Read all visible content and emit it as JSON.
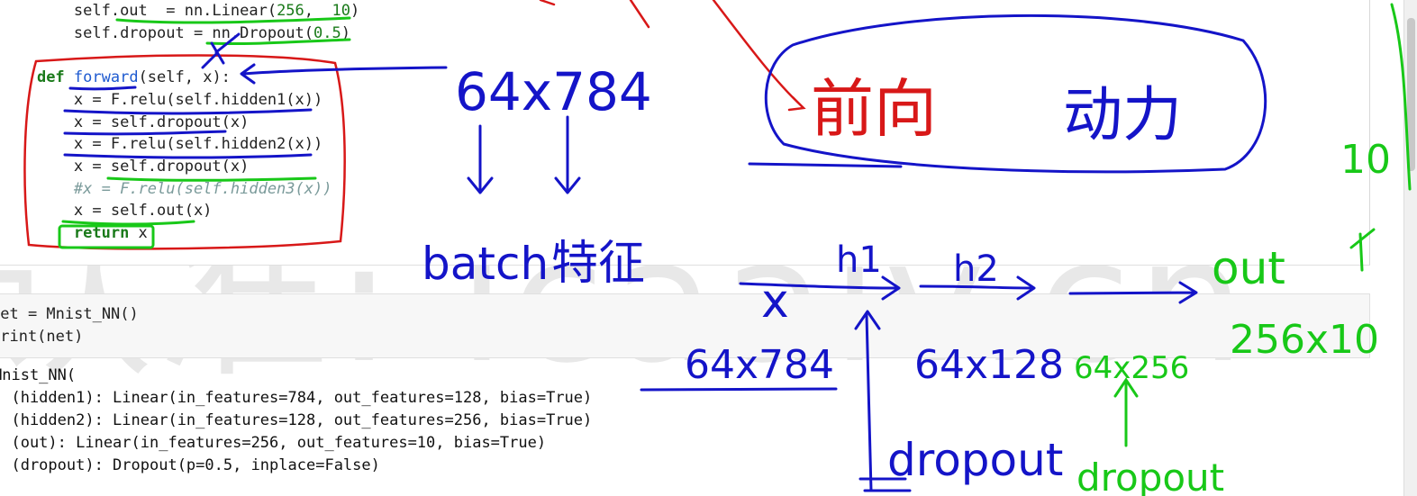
{
  "code_cell": {
    "lines": [
      {
        "indent": "    ",
        "parts": [
          {
            "t": "self.out  = nn.Linear(",
            "c": ""
          },
          {
            "t": "256",
            "c": "num"
          },
          {
            "t": ",  ",
            "c": ""
          },
          {
            "t": "10",
            "c": "num"
          },
          {
            "t": ")",
            "c": ""
          }
        ]
      },
      {
        "indent": "    ",
        "parts": [
          {
            "t": "self.dropout = nn.Dropout(",
            "c": ""
          },
          {
            "t": "0.5",
            "c": "num"
          },
          {
            "t": ")",
            "c": ""
          }
        ]
      },
      {
        "indent": "",
        "parts": [
          {
            "t": "",
            "c": ""
          }
        ]
      },
      {
        "indent": "",
        "parts": [
          {
            "t": "def ",
            "c": "kw"
          },
          {
            "t": "forward",
            "c": "fn"
          },
          {
            "t": "(self, x):",
            "c": ""
          }
        ]
      },
      {
        "indent": "    ",
        "parts": [
          {
            "t": "x = F.relu(self.hidden1(x))",
            "c": ""
          }
        ]
      },
      {
        "indent": "    ",
        "parts": [
          {
            "t": "x = self.dropout(x)",
            "c": ""
          }
        ]
      },
      {
        "indent": "    ",
        "parts": [
          {
            "t": "x = F.relu(self.hidden2(x))",
            "c": ""
          }
        ]
      },
      {
        "indent": "    ",
        "parts": [
          {
            "t": "x = self.dropout(x)",
            "c": ""
          }
        ]
      },
      {
        "indent": "    ",
        "parts": [
          {
            "t": "#x = F.relu(self.hidden3(x))",
            "c": "cm"
          }
        ]
      },
      {
        "indent": "    ",
        "parts": [
          {
            "t": "x = self.out(x)",
            "c": ""
          }
        ]
      },
      {
        "indent": "    ",
        "parts": [
          {
            "t": "return",
            "c": "kw"
          },
          {
            "t": " x",
            "c": ""
          }
        ]
      }
    ]
  },
  "net_cell": {
    "lines": [
      "net = Mnist_NN()",
      "print(net)"
    ]
  },
  "output": {
    "lines": [
      "Mnist_NN(",
      "  (hidden1): Linear(in_features=784, out_features=128, bias=True)",
      "  (hidden2): Linear(in_features=128, out_features=256, bias=True)",
      "  (out): Linear(in_features=256, out_features=10, bias=True)",
      "  (dropout): Dropout(p=0.5, inplace=False)"
    ]
  },
  "watermark": "认准: lcaaiv.cn",
  "annotations": {
    "blue": {
      "shape": "64x784",
      "batch": "batch",
      "features": "特征",
      "forward_word": "前向",
      "power_word": "动力",
      "x": "x",
      "h1": "h1",
      "h2": "h2",
      "input_shape": "64x784",
      "h1_shape": "64x128",
      "dropout": "dropout"
    },
    "green": {
      "ten": "10",
      "out": "out",
      "shape_out": "256x10",
      "shape_h2": "64x256",
      "dropout": "dropout"
    }
  },
  "colors": {
    "blue_ink": "#1414c8",
    "red_ink": "#d81818",
    "green_ink": "#18c818",
    "keyword": "#1a7a1a"
  }
}
